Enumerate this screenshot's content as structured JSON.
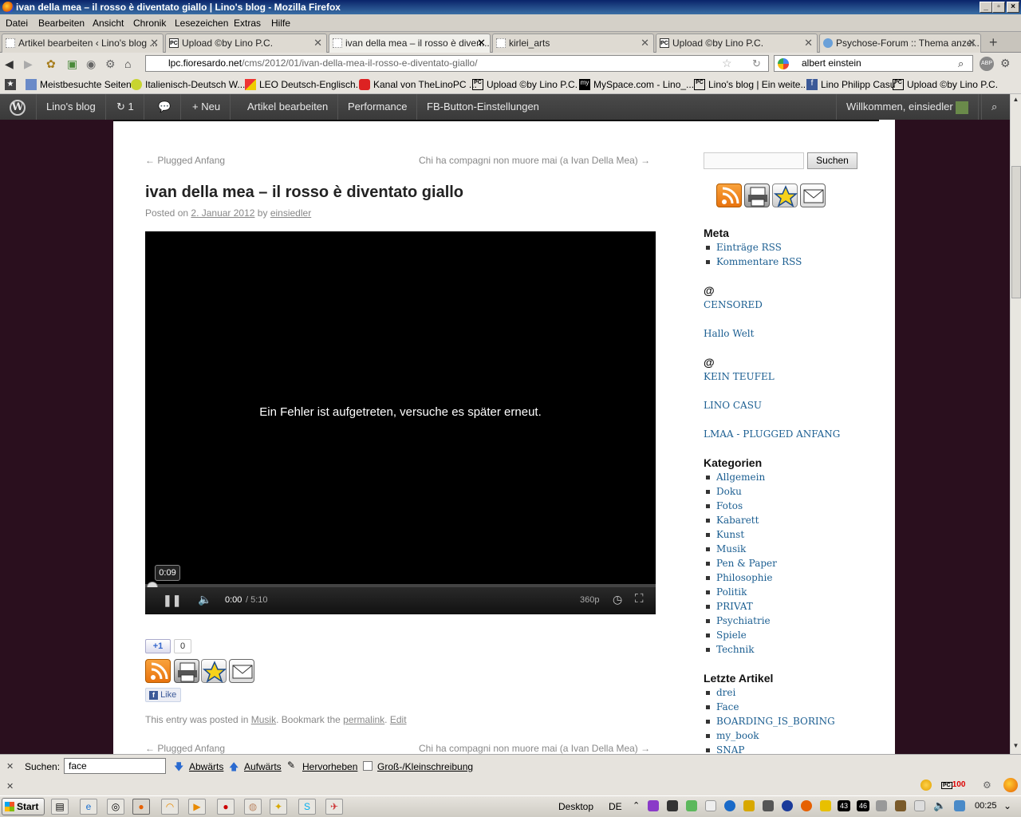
{
  "window": {
    "title": "ivan della mea – il rosso è diventato giallo | Lino's blog - Mozilla Firefox"
  },
  "menu": [
    "Datei",
    "Bearbeiten",
    "Ansicht",
    "Chronik",
    "Lesezeichen",
    "Extras",
    "Hilfe"
  ],
  "tabs": [
    {
      "label": "Artikel bearbeiten ‹ Lino's blog ..."
    },
    {
      "label": "Upload ©by Lino P.C."
    },
    {
      "label": "ivan della mea – il rosso è diven..."
    },
    {
      "label": "kirlei_arts"
    },
    {
      "label": "Upload ©by Lino P.C."
    },
    {
      "label": "Psychose-Forum :: Thema anzei..."
    }
  ],
  "tab_close": "✕",
  "new_tab": "+",
  "address": {
    "host": "lpc.fioresardo.net",
    "path": "/cms/2012/01/ivan-della-mea-il-rosso-e-diventato-giallo/"
  },
  "search": {
    "value": "albert einstein"
  },
  "bookmarks": [
    "Meistbesuchte Seiten",
    "Italienisch-Deutsch W...",
    "LEO Deutsch-Englisch...",
    "Kanal von TheLinoPC ...",
    "Upload ©by Lino P.C.",
    "MySpace.com - Lino_...",
    "Lino's blog | Ein weite...",
    "Lino Philipp Casu",
    "Upload ©by Lino P.C."
  ],
  "wpbar": {
    "site": "Lino's blog",
    "updates": "1",
    "new": "Neu",
    "edit": "Artikel bearbeiten",
    "performance": "Performance",
    "fb": "FB-Button-Einstellungen",
    "welcome": "Willkommen, einsiedler"
  },
  "post": {
    "prev": "← Plugged Anfang",
    "next": "Chi ha compagni non muore mai (a Ivan Della Mea) →",
    "title": "ivan della mea – il rosso è diventato giallo",
    "posted_on": "Posted on",
    "date": "2. Januar 2012",
    "by": "by",
    "author": "einsiedler",
    "gplus": "+1",
    "gplus_count": "0",
    "like": "Like",
    "footer_a": "This entry was posted in",
    "footer_cat": "Musik",
    "footer_b": ". Bookmark the",
    "footer_perma": "permalink",
    "footer_c": ".",
    "footer_edit": "Edit"
  },
  "video": {
    "error": "Ein Fehler ist aufgetreten, versuche es später erneut.",
    "tooltip": "0:09",
    "time": "0:00",
    "duration": "/ 5:10",
    "quality": "360p"
  },
  "sidebar": {
    "search_button": "Suchen",
    "meta_title": "Meta",
    "meta": [
      "Einträge RSS",
      "Kommentare RSS"
    ],
    "at1": "@",
    "at1_links": [
      "CENSORED",
      "Hallo Welt"
    ],
    "at2": "@",
    "at2_links": [
      "KEIN TEUFEL",
      "LINO CASU",
      "LMAA - PLUGGED ANFANG"
    ],
    "cat_title": "Kategorien",
    "categories": [
      "Allgemein",
      "Doku",
      "Fotos",
      "Kabarett",
      "Kunst",
      "Musik",
      "Pen & Paper",
      "Philosophie",
      "Politik",
      "PRIVAT",
      "Psychiatrie",
      "Spiele",
      "Technik"
    ],
    "recent_title": "Letzte Artikel",
    "recent": [
      "drei",
      "Face",
      "BOARDING_IS_BORING",
      "my_book",
      "SNAP"
    ]
  },
  "findbar": {
    "label": "Suchen:",
    "value": "face",
    "down": "Abwärts",
    "up": "Aufwärts",
    "highlight": "Hervorheben",
    "case": "Groß-/Kleinschreibung",
    "close": "✕"
  },
  "statusbar": {
    "close": "✕",
    "pc_badge": "100"
  },
  "taskbar": {
    "start": "Start",
    "desktop": "Desktop",
    "lang": "DE",
    "clock": "00:25",
    "tray_num1": "43",
    "tray_num2": "46"
  },
  "colors": {
    "wp_bar": "#464646",
    "page_bg": "#2a0f1e",
    "link": "#1b5e91"
  }
}
